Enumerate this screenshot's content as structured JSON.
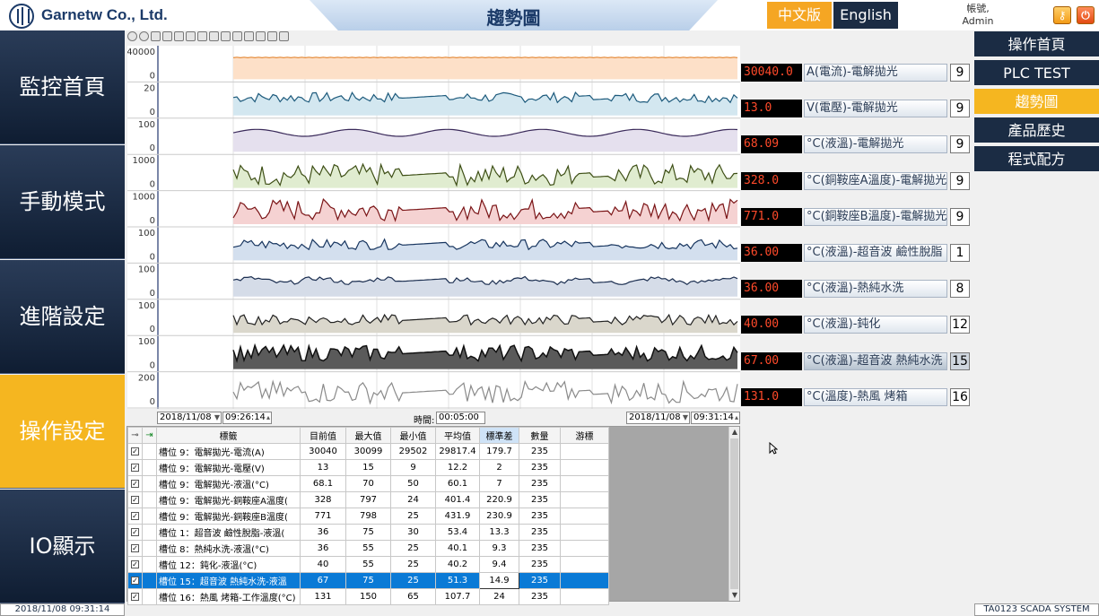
{
  "header": {
    "company": "Garnetw Co., Ltd.",
    "title": "趨勢圖",
    "lang_zh": "中文版",
    "lang_en": "English",
    "user_label": "帳號,",
    "user_name": "Admin"
  },
  "left_nav": [
    {
      "label": "監控首頁",
      "active": false
    },
    {
      "label": "手動模式",
      "active": false
    },
    {
      "label": "進階設定",
      "active": false
    },
    {
      "label": "操作設定",
      "active": true
    },
    {
      "label": "IO顯示",
      "active": false
    }
  ],
  "right_menu": [
    {
      "label": "操作首頁",
      "active": false
    },
    {
      "label": "PLC TEST",
      "active": false
    },
    {
      "label": "趨勢圖",
      "active": true
    },
    {
      "label": "產品歷史",
      "active": false
    },
    {
      "label": "程式配方",
      "active": false
    }
  ],
  "colors": {
    "nav_dark": "#1b2c44",
    "accent": "#f5b620",
    "selected_row": "#0a7ad6",
    "value_text": "#ff4a2a"
  },
  "chart_data": [
    {
      "type": "area",
      "ylim": [
        0,
        40000
      ],
      "tick_labels": [
        "40000",
        "0"
      ],
      "color": "#e58b3a",
      "fill": "#fde0c8",
      "style": "flat",
      "level": 0.75
    },
    {
      "type": "area",
      "ylim": [
        0,
        20
      ],
      "tick_labels": [
        "20",
        "0"
      ],
      "color": "#1d5a7c",
      "fill": "#d3e7f0",
      "style": "noise",
      "level": 0.62
    },
    {
      "type": "area",
      "ylim": [
        0,
        100
      ],
      "tick_labels": [
        "100",
        "0"
      ],
      "color": "#3a2a5a",
      "fill": "#e5e0ee",
      "style": "wave",
      "level": 0.65
    },
    {
      "type": "area",
      "ylim": [
        0,
        1000
      ],
      "tick_labels": [
        "1000",
        "0"
      ],
      "color": "#3e4f16",
      "fill": "#e0ecd0",
      "style": "spiky",
      "level": 0.45
    },
    {
      "type": "area",
      "ylim": [
        0,
        1000
      ],
      "tick_labels": [
        "1000",
        "0"
      ],
      "color": "#7a1416",
      "fill": "#f5d2d2",
      "style": "spiky",
      "level": 0.5
    },
    {
      "type": "area",
      "ylim": [
        0,
        100
      ],
      "tick_labels": [
        "100",
        "0"
      ],
      "color": "#16345e",
      "fill": "#d3dfee",
      "style": "noise",
      "level": 0.55
    },
    {
      "type": "area",
      "ylim": [
        0,
        100
      ],
      "tick_labels": [
        "100",
        "0"
      ],
      "color": "#1b2e50",
      "fill": "#d5dce8",
      "style": "wave-noise",
      "level": 0.55
    },
    {
      "type": "area",
      "ylim": [
        0,
        100
      ],
      "tick_labels": [
        "100",
        "0"
      ],
      "color": "#222222",
      "fill": "#dad7cc",
      "style": "noise",
      "level": 0.45
    },
    {
      "type": "area",
      "ylim": [
        0,
        100
      ],
      "tick_labels": [
        "100",
        "0"
      ],
      "color": "#111111",
      "fill": "#5a5a5a",
      "style": "spiky-dense",
      "level": 0.55
    },
    {
      "type": "line",
      "ylim": [
        0,
        200
      ],
      "tick_labels": [
        "200",
        "0"
      ],
      "color": "#8a8a8a",
      "fill": "none",
      "style": "spiky",
      "level": 0.45
    }
  ],
  "channels": [
    {
      "value": "30040.0",
      "label": "A(電流)-電解拋光",
      "num": "9",
      "highlight": false
    },
    {
      "value": "13.0",
      "label": "V(電壓)-電解拋光",
      "num": "9",
      "highlight": false
    },
    {
      "value": "68.09",
      "label": "°C(液溫)-電解拋光",
      "num": "9",
      "highlight": false
    },
    {
      "value": "328.0",
      "label": "°C(銅鞍座A溫度)-電解拋光",
      "num": "9",
      "highlight": false
    },
    {
      "value": "771.0",
      "label": "°C(銅鞍座B溫度)-電解拋光",
      "num": "9",
      "highlight": false
    },
    {
      "value": "36.00",
      "label": "°C(液溫)-超音波 鹼性脫脂",
      "num": "1",
      "highlight": false
    },
    {
      "value": "36.00",
      "label": "°C(液溫)-熱純水洗",
      "num": "8",
      "highlight": false
    },
    {
      "value": "40.00",
      "label": "°C(液溫)-鈍化",
      "num": "12",
      "highlight": false
    },
    {
      "value": "67.00",
      "label": "°C(液溫)-超音波 熱純水洗",
      "num": "15",
      "highlight": true
    },
    {
      "value": "131.0",
      "label": "°C(溫度)-熱風 烤箱",
      "num": "16",
      "highlight": false
    }
  ],
  "timebar": {
    "start_date": "2018/11/08",
    "start_time": "09:26:14",
    "period_label": "時間:",
    "period": "00:05:00",
    "end_date": "2018/11/08",
    "end_time": "09:31:14"
  },
  "table": {
    "headers": [
      "標籤",
      "目前值",
      "最大值",
      "最小值",
      "平均值",
      "標準差",
      "數量",
      "游標"
    ],
    "rows": [
      {
        "tag": "槽位 9：電解拋光-電流(A)",
        "cur": "30040",
        "max": "30099",
        "min": "29502",
        "avg": "29817.4",
        "std": "179.7",
        "count": "235",
        "cursor": ""
      },
      {
        "tag": "槽位 9：電解拋光-電壓(V)",
        "cur": "13",
        "max": "15",
        "min": "9",
        "avg": "12.2",
        "std": "2",
        "count": "235",
        "cursor": ""
      },
      {
        "tag": "槽位 9：電解拋光-液溫(°C)",
        "cur": "68.1",
        "max": "70",
        "min": "50",
        "avg": "60.1",
        "std": "7",
        "count": "235",
        "cursor": ""
      },
      {
        "tag": "槽位 9：電解拋光-銅鞍座A溫度(",
        "cur": "328",
        "max": "797",
        "min": "24",
        "avg": "401.4",
        "std": "220.9",
        "count": "235",
        "cursor": ""
      },
      {
        "tag": "槽位 9：電解拋光-銅鞍座B溫度(",
        "cur": "771",
        "max": "798",
        "min": "25",
        "avg": "431.9",
        "std": "230.9",
        "count": "235",
        "cursor": ""
      },
      {
        "tag": "槽位 1：超音波 鹼性脫脂-液溫(",
        "cur": "36",
        "max": "75",
        "min": "30",
        "avg": "53.4",
        "std": "13.3",
        "count": "235",
        "cursor": ""
      },
      {
        "tag": "槽位 8：熱純水洗-液溫(°C)",
        "cur": "36",
        "max": "55",
        "min": "25",
        "avg": "40.1",
        "std": "9.3",
        "count": "235",
        "cursor": ""
      },
      {
        "tag": "槽位 12：鈍化-液溫(°C)",
        "cur": "40",
        "max": "55",
        "min": "25",
        "avg": "40.2",
        "std": "9.4",
        "count": "235",
        "cursor": ""
      },
      {
        "tag": "槽位 15：超音波 熱純水洗-液溫",
        "cur": "67",
        "max": "75",
        "min": "25",
        "avg": "51.3",
        "std": "14.9",
        "count": "235",
        "cursor": "",
        "selected": true
      },
      {
        "tag": "槽位 16：熱風 烤箱-工作溫度(°C)",
        "cur": "131",
        "max": "150",
        "min": "65",
        "avg": "107.7",
        "std": "24",
        "count": "235",
        "cursor": ""
      }
    ]
  },
  "status": {
    "datetime": "2018/11/08 09:31:14",
    "system": "TA0123 SCADA SYSTEM"
  }
}
